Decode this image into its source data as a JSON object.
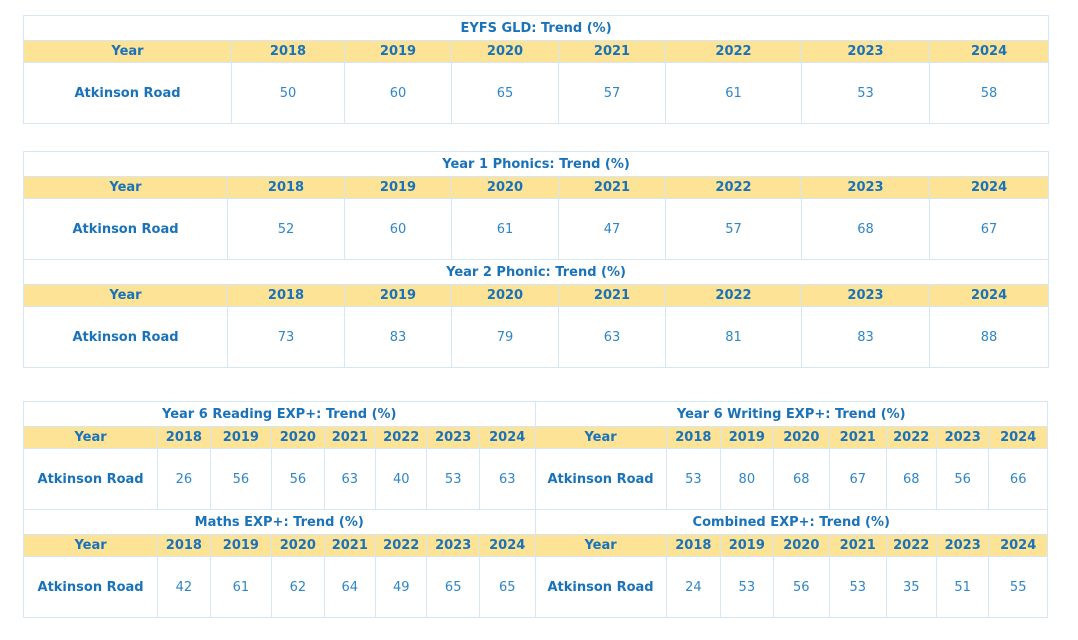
{
  "eyfs": {
    "title": "EYFS GLD: Trend (%)",
    "year_label": "Year",
    "years": [
      "2018",
      "2019",
      "2020",
      "2021",
      "2022",
      "2023",
      "2024"
    ],
    "school": "Atkinson Road",
    "values": [
      "50",
      "60",
      "65",
      "57",
      "61",
      "53",
      "58"
    ]
  },
  "y1_phonics": {
    "title": "Year 1 Phonics: Trend (%)",
    "year_label": "Year",
    "years": [
      "2018",
      "2019",
      "2020",
      "2021",
      "2022",
      "2023",
      "2024"
    ],
    "school": "Atkinson Road",
    "values": [
      "52",
      "60",
      "61",
      "47",
      "57",
      "68",
      "67"
    ]
  },
  "y2_phonic": {
    "title": "Year 2 Phonic: Trend (%)",
    "year_label": "Year",
    "years": [
      "2018",
      "2019",
      "2020",
      "2021",
      "2022",
      "2023",
      "2024"
    ],
    "school": "Atkinson Road",
    "values": [
      "73",
      "83",
      "79",
      "63",
      "81",
      "83",
      "88"
    ]
  },
  "y6_reading": {
    "title": "Year 6 Reading EXP+: Trend (%)",
    "year_label": "Year",
    "years": [
      "2018",
      "2019",
      "2020",
      "2021",
      "2022",
      "2023",
      "2024"
    ],
    "school": "Atkinson Road",
    "values": [
      "26",
      "56",
      "56",
      "63",
      "40",
      "53",
      "63"
    ]
  },
  "y6_writing": {
    "title": "Year 6 Writing EXP+: Trend (%)",
    "year_label": "Year",
    "years": [
      "2018",
      "2019",
      "2020",
      "2021",
      "2022",
      "2023",
      "2024"
    ],
    "school": "Atkinson Road",
    "values": [
      "53",
      "80",
      "68",
      "67",
      "68",
      "56",
      "66"
    ]
  },
  "maths": {
    "title": "Maths EXP+: Trend (%)",
    "year_label": "Year",
    "years": [
      "2018",
      "2019",
      "2020",
      "2021",
      "2022",
      "2023",
      "2024"
    ],
    "school": "Atkinson Road",
    "values": [
      "42",
      "61",
      "62",
      "64",
      "49",
      "65",
      "65"
    ]
  },
  "combined": {
    "title": "Combined EXP+: Trend (%)",
    "year_label": "Year",
    "years": [
      "2018",
      "2019",
      "2020",
      "2021",
      "2022",
      "2023",
      "2024"
    ],
    "school": "Atkinson Road",
    "values": [
      "24",
      "53",
      "56",
      "53",
      "35",
      "51",
      "55"
    ]
  },
  "colors": {
    "header_bg": "#fde396",
    "heading_text": "#1a72b9",
    "value_text": "#2f86c8",
    "border": "#d6e6f5"
  }
}
